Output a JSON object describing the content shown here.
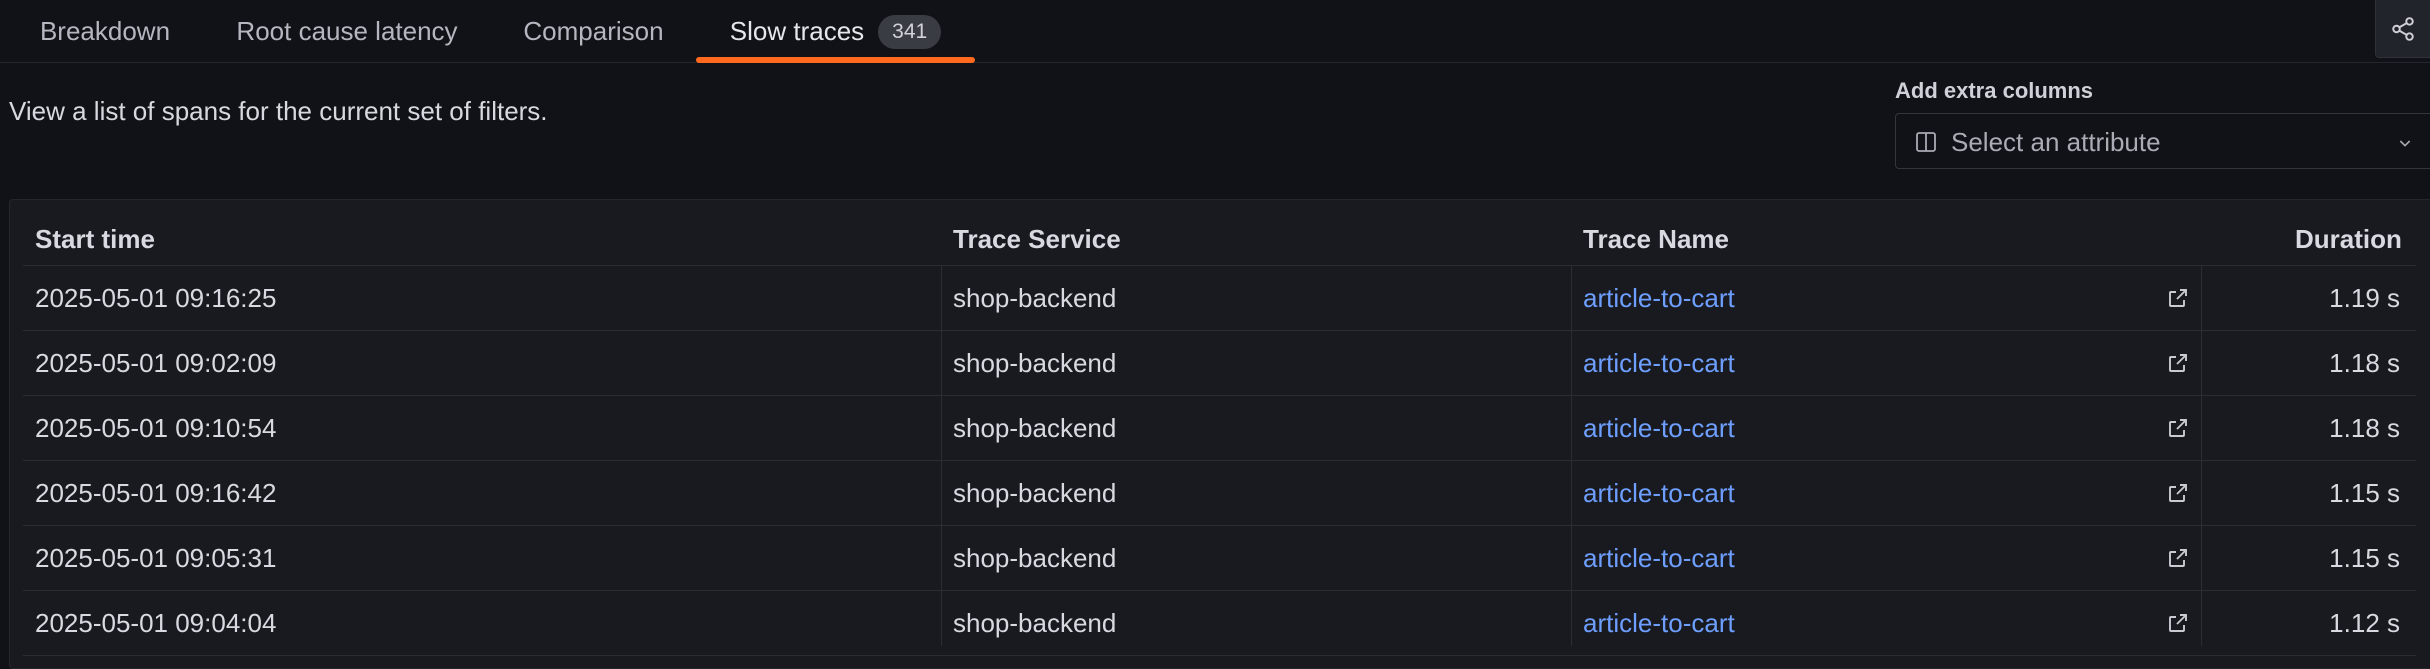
{
  "tabs": [
    {
      "label": "Breakdown"
    },
    {
      "label": "Root cause latency"
    },
    {
      "label": "Comparison"
    },
    {
      "label": "Slow traces",
      "count": "341",
      "active": true
    }
  ],
  "share_icon": "share-icon",
  "description": "View a list of spans for the current set of filters.",
  "extra_columns": {
    "label": "Add extra columns",
    "placeholder": "Select an attribute",
    "icon": "columns-icon"
  },
  "table": {
    "headers": [
      "Start time",
      "Trace Service",
      "Trace Name",
      "Duration"
    ],
    "rows": [
      {
        "start": "2025-05-01 09:16:25",
        "service": "shop-backend",
        "name": "article-to-cart",
        "duration": "1.19 s"
      },
      {
        "start": "2025-05-01 09:02:09",
        "service": "shop-backend",
        "name": "article-to-cart",
        "duration": "1.18 s"
      },
      {
        "start": "2025-05-01 09:10:54",
        "service": "shop-backend",
        "name": "article-to-cart",
        "duration": "1.18 s"
      },
      {
        "start": "2025-05-01 09:16:42",
        "service": "shop-backend",
        "name": "article-to-cart",
        "duration": "1.15 s"
      },
      {
        "start": "2025-05-01 09:05:31",
        "service": "shop-backend",
        "name": "article-to-cart",
        "duration": "1.15 s"
      },
      {
        "start": "2025-05-01 09:04:04",
        "service": "shop-backend",
        "name": "article-to-cart",
        "duration": "1.12 s"
      }
    ]
  },
  "colors": {
    "background": "#111217",
    "accent": "#ff6a1f",
    "link": "#6e9fff"
  }
}
